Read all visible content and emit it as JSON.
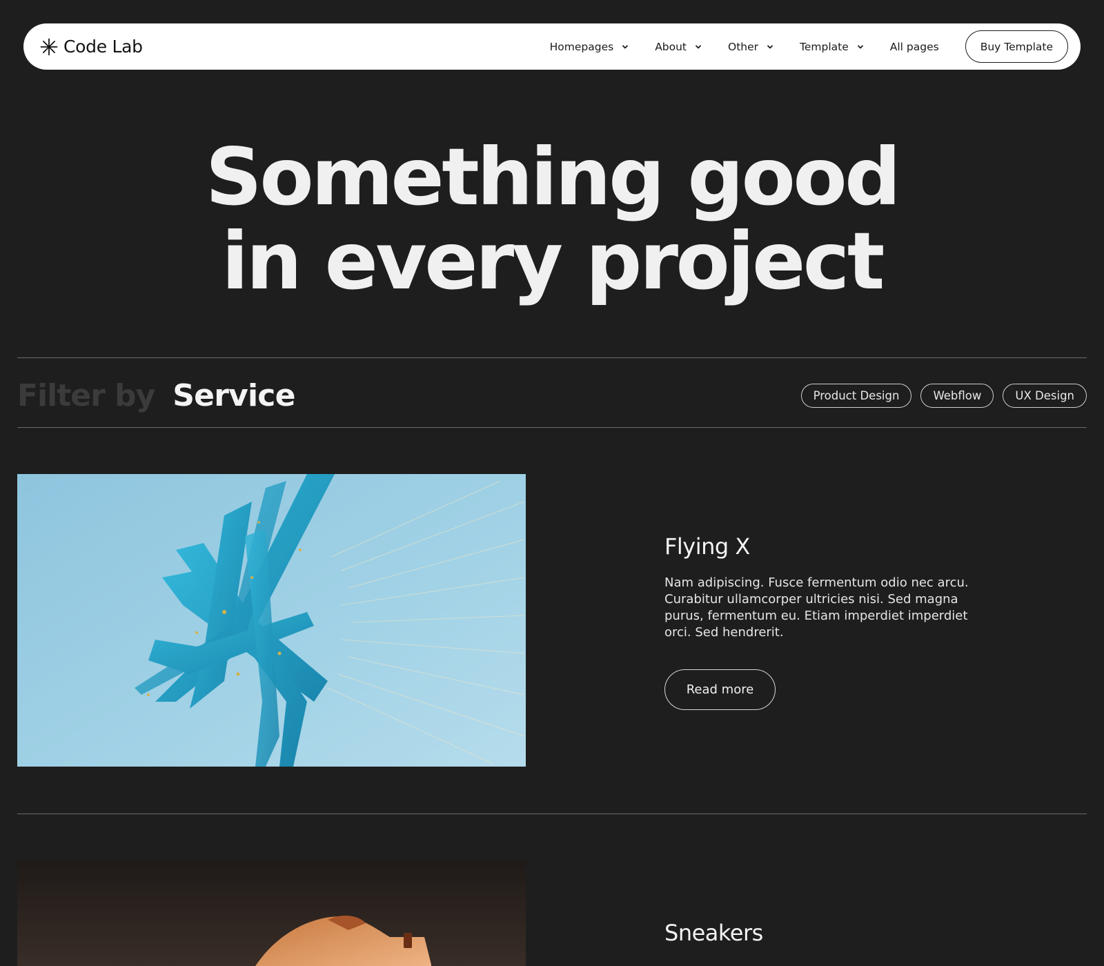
{
  "nav": {
    "brand": "Code Lab",
    "items": [
      {
        "label": "Homepages",
        "has_dropdown": true
      },
      {
        "label": "About",
        "has_dropdown": true
      },
      {
        "label": "Other",
        "has_dropdown": true
      },
      {
        "label": "Template",
        "has_dropdown": true
      },
      {
        "label": "All pages",
        "has_dropdown": false
      }
    ],
    "cta": "Buy Template"
  },
  "hero": {
    "line1": "Something good",
    "line2": "in every project"
  },
  "filter": {
    "label": "Filter by",
    "value": "Service",
    "chips": [
      "Product Design",
      "Webflow",
      "UX Design"
    ]
  },
  "projects": [
    {
      "title": "Flying X",
      "description": "Nam adipiscing. Fusce fermentum odio nec arcu. Curabitur ullamcorper ultricies nisi. Sed magna purus, fermentum eu. Etiam imperdiet imperdiet orci. Sed hendrerit.",
      "button": "Read more",
      "image": "blue-ribbon-sculpture"
    },
    {
      "title": "Sneakers",
      "image": "orange-sneaker"
    }
  ],
  "colors": {
    "background": "#1e1e1e",
    "nav_bg": "#ffffff",
    "text": "#f2f2f2",
    "muted_text": "#3b3b3b",
    "rule": "#6a6a6a",
    "image_blue": "#9fd0e6",
    "ribbon_blue": "#1fa3c8"
  },
  "icons": {
    "brand": "asterisk-icon",
    "dropdown": "chevron-down-icon"
  }
}
